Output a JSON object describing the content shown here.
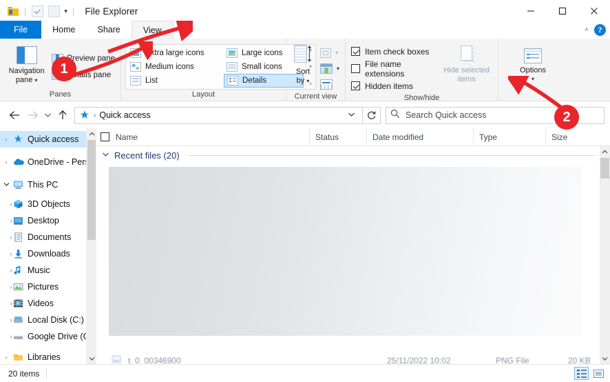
{
  "window": {
    "title": "File Explorer",
    "quick_access_toolbar": [
      {
        "name": "folder-icon"
      },
      {
        "name": "properties-icon"
      },
      {
        "name": "new-folder-icon"
      },
      {
        "name": "customize-caret-icon",
        "label": "▾"
      }
    ],
    "controls": {
      "minimize": "—",
      "maximize": "□",
      "close": "✕",
      "collapse_ribbon": "˄",
      "help": "?"
    }
  },
  "tabs": [
    {
      "label": "File",
      "active": false,
      "style": "file"
    },
    {
      "label": "Home",
      "active": false
    },
    {
      "label": "Share",
      "active": false
    },
    {
      "label": "View",
      "active": true
    }
  ],
  "ribbon": {
    "groups": [
      {
        "name": "panes",
        "label": "Panes",
        "big_button": {
          "line1": "Navigation",
          "line2": "pane",
          "caret": "▾"
        },
        "small_buttons": [
          {
            "label": "Preview pane",
            "enabled": true
          },
          {
            "label": "Details pane",
            "enabled": true
          }
        ]
      },
      {
        "name": "layout",
        "label": "Layout",
        "options": [
          {
            "label": "Extra large icons",
            "selected": false
          },
          {
            "label": "Large icons",
            "selected": false
          },
          {
            "label": "Medium icons",
            "selected": false
          },
          {
            "label": "Small icons",
            "selected": false
          },
          {
            "label": "List",
            "selected": false
          },
          {
            "label": "Details",
            "selected": true
          }
        ],
        "scroll": {
          "up": "▴",
          "down": "▾",
          "more": "≡"
        }
      },
      {
        "name": "current-view",
        "label": "Current view",
        "sort_by": {
          "line1": "Sort",
          "line2": "by",
          "caret": "▾"
        },
        "small_buttons": [
          {
            "label": "Group by",
            "enabled": false,
            "caret": "▾"
          },
          {
            "label": "Add columns",
            "enabled": true,
            "caret": "▾"
          },
          {
            "label": "Size all columns to fit",
            "enabled": true
          }
        ]
      },
      {
        "name": "show-hide",
        "label": "Show/hide",
        "checkboxes": [
          {
            "label": "Item check boxes",
            "checked": true
          },
          {
            "label": "File name extensions",
            "checked": false
          },
          {
            "label": "Hidden items",
            "checked": true
          }
        ],
        "big_button": {
          "line1": "Hide selected",
          "line2": "items",
          "enabled": false
        }
      },
      {
        "name": "options",
        "label": "",
        "big_button": {
          "line1": "Options",
          "caret": "▾"
        }
      }
    ]
  },
  "address_bar": {
    "back": "←",
    "forward": "→",
    "recent_caret": "▾",
    "up": "↑",
    "breadcrumb_icon": "quick-access-star-icon",
    "breadcrumb_separator": "›",
    "breadcrumb": "Quick access",
    "dropdown_caret": "▾",
    "refresh": "↻",
    "search_placeholder": "Search Quick access"
  },
  "nav_pane": {
    "items": [
      {
        "label": "Quick access",
        "icon": "star-icon",
        "expander": "›",
        "indent": 0,
        "selected": true
      },
      {
        "label": "OneDrive - Person",
        "icon": "onedrive-cloud-icon",
        "expander": "›",
        "indent": 0,
        "selected": false
      },
      {
        "label": "This PC",
        "icon": "this-pc-icon",
        "expander": "⌄",
        "indent": 0,
        "selected": false,
        "expanded": true
      },
      {
        "label": "3D Objects",
        "icon": "3d-objects-icon",
        "expander": "›",
        "indent": 1,
        "selected": false
      },
      {
        "label": "Desktop",
        "icon": "desktop-icon",
        "expander": "›",
        "indent": 1,
        "selected": false
      },
      {
        "label": "Documents",
        "icon": "documents-icon",
        "expander": "›",
        "indent": 1,
        "selected": false
      },
      {
        "label": "Downloads",
        "icon": "downloads-icon",
        "expander": "›",
        "indent": 1,
        "selected": false
      },
      {
        "label": "Music",
        "icon": "music-icon",
        "expander": "›",
        "indent": 1,
        "selected": false
      },
      {
        "label": "Pictures",
        "icon": "pictures-icon",
        "expander": "›",
        "indent": 1,
        "selected": false
      },
      {
        "label": "Videos",
        "icon": "videos-icon",
        "expander": "›",
        "indent": 1,
        "selected": false
      },
      {
        "label": "Local Disk (C:)",
        "icon": "local-disk-icon",
        "expander": "›",
        "indent": 1,
        "selected": false
      },
      {
        "label": "Google Drive (G:",
        "icon": "network-drive-icon",
        "expander": "›",
        "indent": 1,
        "selected": false
      },
      {
        "label": "Libraries",
        "icon": "libraries-folder-icon",
        "expander": "›",
        "indent": 0,
        "selected": false
      }
    ],
    "scrollbar": {
      "up": "˄",
      "down": "˅"
    }
  },
  "file_list": {
    "columns": [
      {
        "label": "Name"
      },
      {
        "label": "Status"
      },
      {
        "label": "Date modified"
      },
      {
        "label": "Type"
      },
      {
        "label": "Size"
      }
    ],
    "group": {
      "chevron": "⌄",
      "label": "Recent files (20)"
    },
    "partial_row": {
      "name": "t_0_00346900",
      "date_modified": "25/11/2022 10:02",
      "type": "PNG File",
      "size": "20 KB"
    },
    "scrollbar": {
      "up": "˄",
      "down": "˅"
    }
  },
  "status_bar": {
    "item_count": "20 items",
    "view_buttons": [
      {
        "name": "details-view-button",
        "active": true
      },
      {
        "name": "large-icons-view-button",
        "active": false
      }
    ]
  },
  "annotations": [
    {
      "label": "1",
      "target": "panes-group"
    },
    {
      "label": "2",
      "target": "options-button"
    }
  ],
  "colors": {
    "accent": "#0078d7",
    "annotation_red": "#e8262a",
    "selection_blue": "#cce8ff",
    "ribbon_bg": "#f4f4f4"
  }
}
